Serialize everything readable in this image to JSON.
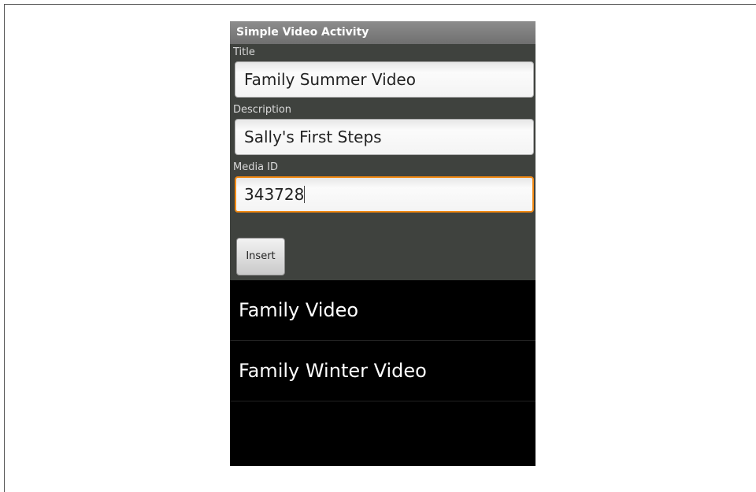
{
  "app": {
    "title": "Simple Video Activity"
  },
  "form": {
    "title_label": "Title",
    "title_value": "Family Summer Video",
    "description_label": "Description",
    "description_value": "Sally's First Steps",
    "media_id_label": "Media ID",
    "media_id_value": "343728",
    "insert_label": "Insert"
  },
  "list": {
    "items": [
      {
        "label": "Family Video"
      },
      {
        "label": "Family Winter Video"
      }
    ]
  },
  "colors": {
    "focus_border": "#f28a14",
    "list_background": "#000000",
    "form_background": "#3f423e"
  }
}
